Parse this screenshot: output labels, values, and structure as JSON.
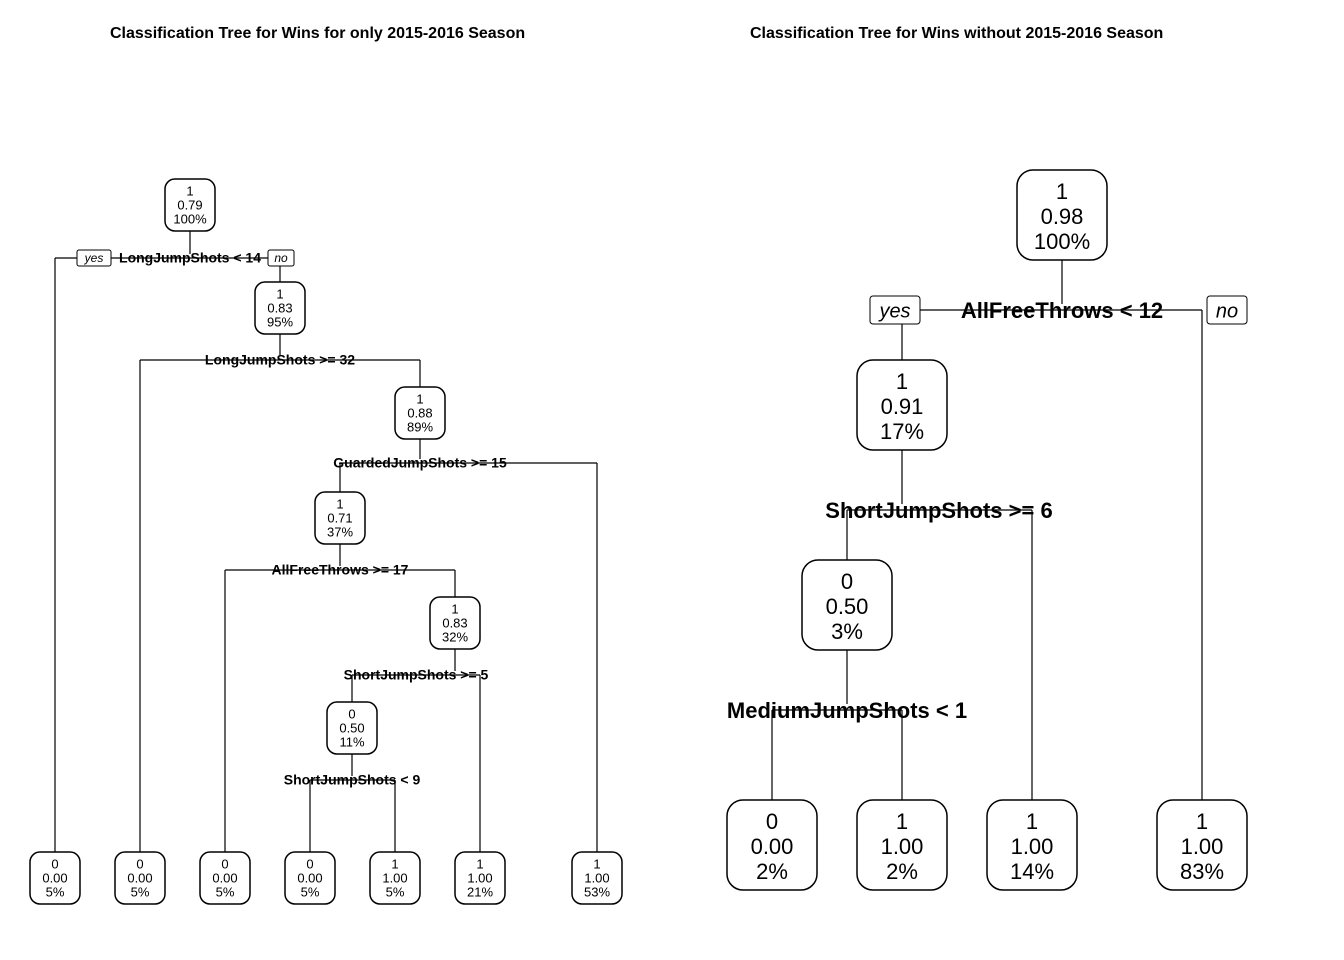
{
  "left": {
    "title": "Classification Tree for Wins for only 2015-2016 Season",
    "yes": "yes",
    "no": "no",
    "splits": [
      "LongJumpShots < 14",
      "LongJumpShots >= 32",
      "GuardedJumpShots >= 15",
      "AllFreeThrows >= 17",
      "ShortJumpShots >= 5",
      "ShortJumpShots < 9"
    ],
    "internal": [
      {
        "class": "1",
        "prob": "0.79",
        "pct": "100%"
      },
      {
        "class": "1",
        "prob": "0.83",
        "pct": "95%"
      },
      {
        "class": "1",
        "prob": "0.88",
        "pct": "89%"
      },
      {
        "class": "1",
        "prob": "0.71",
        "pct": "37%"
      },
      {
        "class": "1",
        "prob": "0.83",
        "pct": "32%"
      },
      {
        "class": "0",
        "prob": "0.50",
        "pct": "11%"
      }
    ],
    "leaves": [
      {
        "class": "0",
        "prob": "0.00",
        "pct": "5%"
      },
      {
        "class": "0",
        "prob": "0.00",
        "pct": "5%"
      },
      {
        "class": "0",
        "prob": "0.00",
        "pct": "5%"
      },
      {
        "class": "0",
        "prob": "0.00",
        "pct": "5%"
      },
      {
        "class": "1",
        "prob": "1.00",
        "pct": "5%"
      },
      {
        "class": "1",
        "prob": "1.00",
        "pct": "21%"
      },
      {
        "class": "1",
        "prob": "1.00",
        "pct": "53%"
      }
    ]
  },
  "right": {
    "title": "Classification Tree for Wins without 2015-2016 Season",
    "yes": "yes",
    "no": "no",
    "splits": [
      "AllFreeThrows < 12",
      "ShortJumpShots >= 6",
      "MediumJumpShots < 1"
    ],
    "internal": [
      {
        "class": "1",
        "prob": "0.98",
        "pct": "100%"
      },
      {
        "class": "1",
        "prob": "0.91",
        "pct": "17%"
      },
      {
        "class": "0",
        "prob": "0.50",
        "pct": "3%"
      }
    ],
    "leaves": [
      {
        "class": "0",
        "prob": "0.00",
        "pct": "2%"
      },
      {
        "class": "1",
        "prob": "1.00",
        "pct": "2%"
      },
      {
        "class": "1",
        "prob": "1.00",
        "pct": "14%"
      },
      {
        "class": "1",
        "prob": "1.00",
        "pct": "83%"
      }
    ]
  }
}
